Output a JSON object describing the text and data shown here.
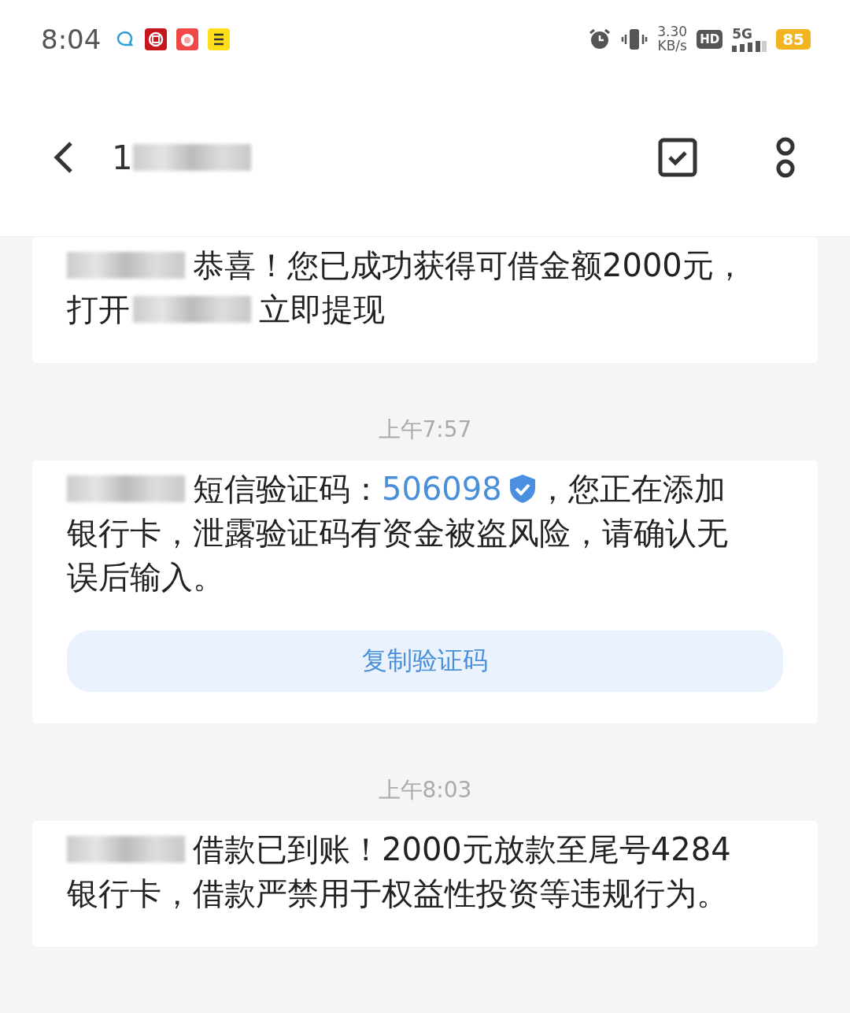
{
  "status_bar": {
    "time": "8:04",
    "speed": "3.30",
    "speed_unit": "KB/s",
    "hd": "HD",
    "network": "5G",
    "battery": "85"
  },
  "header": {
    "title": "1"
  },
  "messages": [
    {
      "kind": "card",
      "lines": [
        [
          {
            "kind": "redacted"
          },
          {
            "kind": "text",
            "text": "恭喜！您已成功获得可借金额2000元，"
          }
        ],
        [
          {
            "kind": "text",
            "text": "打开"
          },
          {
            "kind": "redacted"
          },
          {
            "kind": "text",
            "text": "立即提现"
          }
        ]
      ]
    },
    {
      "kind": "time",
      "text": "上午7:57"
    },
    {
      "kind": "card",
      "lines": [
        [
          {
            "kind": "redacted"
          },
          {
            "kind": "text",
            "text": "短信验证码："
          },
          {
            "kind": "code",
            "text": "506098"
          },
          {
            "kind": "text",
            "text": "，您正在添加"
          }
        ],
        [
          {
            "kind": "text",
            "text": "银行卡，泄露验证码有资金被盗风险，请确认无"
          }
        ],
        [
          {
            "kind": "text",
            "text": "误后输入。"
          }
        ]
      ],
      "button": "复制验证码"
    },
    {
      "kind": "time",
      "text": "上午8:03"
    },
    {
      "kind": "card",
      "lines": [
        [
          {
            "kind": "redacted"
          },
          {
            "kind": "text",
            "text": "借款已到账！2000元放款至尾号4284"
          }
        ],
        [
          {
            "kind": "text",
            "text": "银行卡，借款严禁用于权益性投资等违规行为。"
          }
        ]
      ]
    }
  ]
}
